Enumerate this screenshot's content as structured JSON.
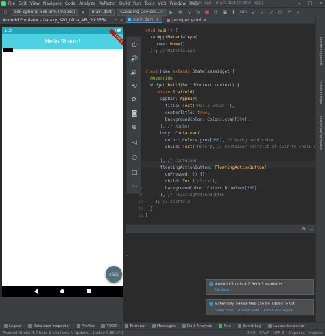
{
  "ide": {
    "menu": [
      "File",
      "Edit",
      "View",
      "Navigate",
      "Code",
      "Analyze",
      "Refactor",
      "Build",
      "Run",
      "Tools",
      "VCS",
      "Window",
      "Help"
    ],
    "window_title": "flutter_app - main.dart [flutter_app]",
    "toolbar": {
      "device_combo": "sdk gphone x86 arm (mobile)",
      "file_combo": "main.dart",
      "loading_combo": "<Loading Devices...>",
      "git_label": "Git:"
    },
    "tabs": [
      {
        "label": "main.dart",
        "active": true
      },
      {
        "label": "pubspec.yaml",
        "active": false
      }
    ]
  },
  "emulator": {
    "title": "Android Emulator - Galaxy_S20_Ultra_API_30:5554",
    "status_time": "1:39",
    "app_title": "Hello Shaun!",
    "debug_banner": "DEBUG",
    "fab_label": "click",
    "controls": [
      "power-icon",
      "volume-up-icon",
      "volume-down-icon",
      "rotate-left-icon",
      "rotate-right-icon",
      "camera-icon",
      "zoom-icon",
      "back-icon",
      "home-icon",
      "overview-icon",
      "more-icon"
    ]
  },
  "code_lines": [
    {
      "n": "",
      "html": "<span class=\"kw\">void</span> <span class=\"fn\">main</span>() {"
    },
    {
      "n": "",
      "html": "  runApp(<span class=\"fn\">MaterialApp</span>("
    },
    {
      "n": "",
      "html": "    home: <span class=\"fn\">Home</span>(),"
    },
    {
      "n": "",
      "html": "  )); <span class=\"cm\">// MaterialApp</span>"
    },
    {
      "n": "",
      "html": ""
    },
    {
      "n": "",
      "html": ""
    },
    {
      "n": "",
      "html": "<span class=\"kw\">class</span> Home <span class=\"kw\">extends</span> StatelessWidget {"
    },
    {
      "n": "",
      "html": "  <span class=\"an\">@override</span>"
    },
    {
      "n": "",
      "html": "  Widget <span class=\"fn\">build</span>(BuildContext context) {"
    },
    {
      "n": "",
      "html": "    <span class=\"kw\">return</span> <span class=\"fn\">Scaffold</span>("
    },
    {
      "n": "",
      "html": "      appBar: <span class=\"fn\">AppBar</span>("
    },
    {
      "n": "",
      "html": "        title: <span class=\"fn\">Text</span>(<span class=\"str\">'Hello Shaun!'</span>),"
    },
    {
      "n": "",
      "html": "        centerTitle: <span class=\"kw\">true</span>,"
    },
    {
      "n": "",
      "html": "        backgroundColor: Colors.cyan[<span class=\"num\">300</span>],"
    },
    {
      "n": "",
      "html": "      ), <span class=\"cm\">// AppBar</span>"
    },
    {
      "n": "",
      "html": "      body: <span class=\"fn\">Container</span>("
    },
    {
      "n": "",
      "html": "        color: Colors.grey[<span class=\"num\">900</span>], <span class=\"cm\">// background color</span>"
    },
    {
      "n": "",
      "html": "        child: <span class=\"fn\">Text</span>(<span class=\"str\">'Helo'</span>), <span class=\"cm\">// Container restrict it self to child widget</span>"
    },
    {
      "n": "",
      "html": ""
    },
    {
      "n": "",
      "html": "      ), <span class=\"cm\">// Container</span>"
    },
    {
      "n": "",
      "html": "      floatingActionButton: <span class=\"fn\">FloatingActionButton</span>("
    },
    {
      "n": "",
      "html": "        onPressed: () {},"
    },
    {
      "n": "",
      "html": "        child: <span class=\"fn\">Text</span>(<span class=\"str\">'click'</span>),"
    },
    {
      "n": "",
      "html": "        backgroundColor: Colors.blueGrey[<span class=\"num\">300</span>],"
    },
    {
      "n": "",
      "html": "      ), <span class=\"cm\">// FloatingActionButton</span>"
    },
    {
      "n": "",
      "html": "    ); <span class=\"cm\">// Scaffold</span>"
    },
    {
      "n": "",
      "html": "  }"
    },
    {
      "n": "",
      "html": "}"
    }
  ],
  "gutter_numbers": [
    "",
    "",
    "",
    "",
    "",
    "",
    "",
    "",
    "",
    "",
    "",
    "",
    "",
    "",
    "",
    "",
    "",
    "",
    "",
    "",
    "",
    "",
    "",
    "26",
    "27",
    "28",
    "29",
    "30"
  ],
  "right_strip": [
    "Flutter Inspector",
    "Flutter Outline",
    "Flutter Performance"
  ],
  "console": {
    "text": "..."
  },
  "notifications": [
    {
      "title": "Android Studio 4.2 Beta 3 available",
      "actions": [
        "Update..."
      ]
    },
    {
      "title": "Externally added files can be added to Git",
      "actions": [
        "View Files",
        "Always Add",
        "Don't Ask Again"
      ]
    }
  ],
  "tool_windows": [
    "Logcat",
    "Database Inspector",
    "Profiler",
    "TODO",
    "Terminal",
    "Messages",
    "Dart Analysis",
    "Run",
    "Event Log",
    "Layout Inspector"
  ],
  "status_bar": {
    "left": "Android Studio 4.2 Beta 3 available // Update... (today 9:35 AM)",
    "position": "20:9",
    "line_sep": "CRLF",
    "encoding": "UTF-8",
    "indent": "2 spaces",
    "branch": "master"
  },
  "colors": {
    "appbar": "#4dd0e1",
    "fab": "#546e7a",
    "ide_bg": "#2b2b2b",
    "panel": "#3c3f41"
  }
}
